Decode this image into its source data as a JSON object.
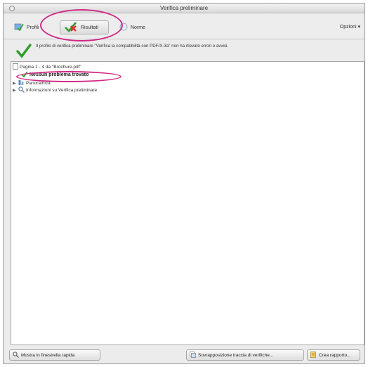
{
  "window": {
    "title": "Verifica preliminare"
  },
  "toolbar": {
    "tabs": [
      {
        "label": "Profili",
        "icon": "profiles-icon"
      },
      {
        "label": "Risultati",
        "icon": "results-check-cross-icon",
        "selected": true
      },
      {
        "label": "Norme",
        "icon": "standards-icon"
      }
    ],
    "options_label": "Opzioni"
  },
  "summary": {
    "text": "Il profilo di verifica preliminare \"Verifica la compatibilità con PDF/X-3a\" non ha rilevato errori o avvisi."
  },
  "tree": {
    "file_row": "Pagina 1 - 4 da \"Brochure.pdf\"",
    "no_problems": "Nessun problema trovato",
    "panoramica": "Panoramica",
    "info": "Informazioni su Verifica preliminare"
  },
  "bottom": {
    "quick_fix_label": "Mostra in finestrella rapida",
    "overprint_label": "Sovrapposizione traccia di verifiche...",
    "report_label": "Crea rapporto..."
  },
  "colors": {
    "highlight": "#d12a86",
    "check_green": "#2e9e2a",
    "cross_red": "#d9322b"
  }
}
